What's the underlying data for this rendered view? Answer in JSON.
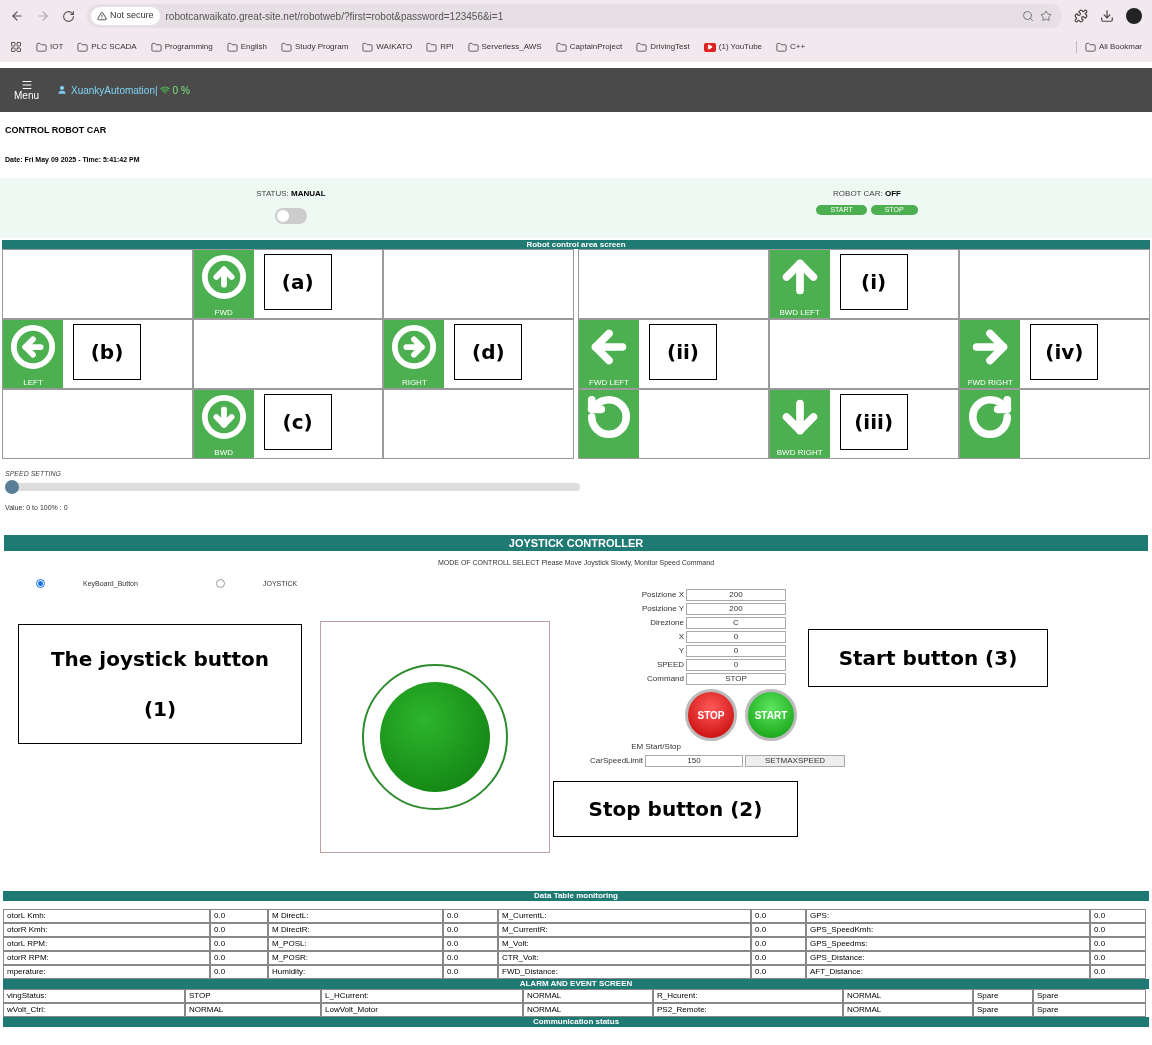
{
  "browser": {
    "security": "Not secure",
    "url": "robotcarwaikato.great-site.net/robotweb/?first=robot&password=123456&i=1",
    "bookmarks": [
      {
        "kind": "folder",
        "label": "IOT"
      },
      {
        "kind": "folder",
        "label": "PLC SCADA"
      },
      {
        "kind": "folder",
        "label": "Programming"
      },
      {
        "kind": "folder",
        "label": "English"
      },
      {
        "kind": "folder",
        "label": "Study Program"
      },
      {
        "kind": "folder",
        "label": "WAIKATO"
      },
      {
        "kind": "folder",
        "label": "RPI"
      },
      {
        "kind": "folder",
        "label": "Serverless_AWS"
      },
      {
        "kind": "folder",
        "label": "CaptainProject"
      },
      {
        "kind": "folder",
        "label": "DrivingTest"
      },
      {
        "kind": "video",
        "label": "(1) YouTube"
      },
      {
        "kind": "folder",
        "label": "C++"
      }
    ],
    "all_bookmarks": "All Bookmar"
  },
  "header": {
    "menu": "Menu",
    "user": "XuankyAutomation|",
    "signal": "0 %"
  },
  "page": {
    "title": "CONTROL ROBOT CAR",
    "date": "Date: Fri May 09 2025 - Time: 5:41:42 PM"
  },
  "status": {
    "label": "STATUS:",
    "mode": "MANUAL",
    "toggle_on": false,
    "car_label": "ROBOT CAR:",
    "car_state": "OFF",
    "buttons": [
      "START",
      "STOP"
    ]
  },
  "control_area": {
    "title": "Robot control area screen",
    "grids": [
      [
        {
          "kind": "empty"
        },
        {
          "kind": "button",
          "label": "FWD",
          "annotation": "(a)"
        },
        {
          "kind": "empty"
        },
        {
          "kind": "button",
          "label": "LEFT",
          "annotation": "(b)"
        },
        {
          "kind": "empty"
        },
        {
          "kind": "button",
          "label": "RIGHT",
          "annotation": "(d)"
        },
        {
          "kind": "empty"
        },
        {
          "kind": "button",
          "label": "BWD",
          "annotation": "(c)"
        },
        {
          "kind": "empty"
        }
      ],
      [
        {
          "kind": "empty"
        },
        {
          "kind": "button",
          "label": "BWD LEFT",
          "annotation": "(i)"
        },
        {
          "kind": "empty"
        },
        {
          "kind": "button",
          "label": "FWD LEFT",
          "annotation": "(ii)"
        },
        {
          "kind": "empty"
        },
        {
          "kind": "button",
          "label": "FWD RIGHT",
          "annotation": "(iv)"
        },
        {
          "kind": "button"
        },
        {
          "kind": "button",
          "label": "BWD RIGHT",
          "annotation": "(iii)"
        },
        {
          "kind": "button"
        }
      ]
    ]
  },
  "speed": {
    "label": "SPEED SETTING",
    "level": 0,
    "reading": "Value: 0 to 100% : 0"
  },
  "joystick": {
    "title": "JOYSTICK CONTROLLER",
    "hint": "MODE OF CONTROLL SELECT Please Move Joystick Slowly, Monitor Speed Command",
    "modes": [
      {
        "label": "KeyBoard_Button",
        "selected": true
      },
      {
        "label": "JOYSTICK",
        "selected": false
      }
    ],
    "fields": [
      {
        "label": "Posizione X",
        "value": "200"
      },
      {
        "label": "Posizione Y",
        "value": "200"
      },
      {
        "label": "Direzione",
        "value": "C"
      },
      {
        "label": "X",
        "value": "0"
      },
      {
        "label": "Y",
        "value": "0"
      },
      {
        "label": "SPEED",
        "value": "0"
      },
      {
        "label": "Command",
        "value": "STOP"
      }
    ],
    "stop": "STOP",
    "start": "START",
    "em_label": "EM Start/Stop",
    "limit_label": "CarSpeedLimit",
    "limit_value": "150",
    "set_button": "SETMAXSPEED",
    "annotations": {
      "joystick": [
        "The joystick button",
        "(1)"
      ],
      "start": "Start button (3)",
      "stop": "Stop button (2)"
    }
  },
  "data_table": {
    "title": "Data Table monitoring",
    "rows": [
      [
        "otorL Kmh:",
        "0.0",
        "M DirectL:",
        "0.0",
        "M_CurrentL:",
        "0.0",
        "GPS:",
        "0.0"
      ],
      [
        "otorR Kmh:",
        "0.0",
        "M DirectR:",
        "0.0",
        "M_CurrentR:",
        "0.0",
        "GPS_SpeedKmh:",
        "0.0"
      ],
      [
        "otorL RPM:",
        "0.0",
        "M_POSL:",
        "0.0",
        "M_Volt:",
        "0.0",
        "GPS_Speedms:",
        "0.0"
      ],
      [
        "otorR RPM:",
        "0.0",
        "M_POSR:",
        "0.0",
        "CTR_Volt:",
        "0.0",
        "GPS_Distance:",
        "0.0"
      ],
      [
        "mperature:",
        "0.0",
        "Humidity:",
        "0.0",
        "FWD_Distance:",
        "0.0",
        "AFT_Distance:",
        "0.0"
      ]
    ]
  },
  "alarm_table": {
    "title": "ALARM AND EVENT SCREEN",
    "rows": [
      [
        "vingStatus:",
        "STOP",
        "L_HCurrent:",
        "NORMAL",
        "R_Hcurent:",
        "NORMAL",
        "Spare",
        "Spare"
      ],
      [
        "wVolt_Ctrl:",
        "NORMAL",
        "LowVolt_Motor",
        "NORMAL",
        "PS2_Remote:",
        "NORMAL",
        "Spare",
        "Spare"
      ]
    ]
  },
  "communication": {
    "title": "Communication status"
  }
}
